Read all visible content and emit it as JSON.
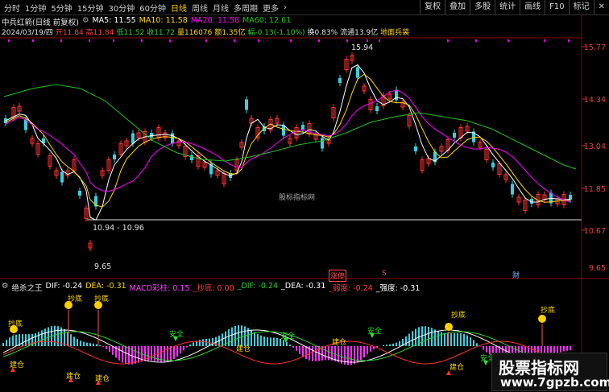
{
  "toolbar": {
    "periods": [
      "分时",
      "1分钟",
      "5分钟",
      "15分钟",
      "30分钟",
      "60分钟",
      "日线",
      "周线",
      "月线",
      "多周期",
      "更多"
    ],
    "active_period": "日线",
    "more_arrow": "›",
    "buttons": [
      "复权",
      "叠加",
      "多股",
      "统计",
      "画线",
      "F10",
      "标记"
    ],
    "close": "✕"
  },
  "ma_row": {
    "name": "中兵红箭(日线 前复权)",
    "gear_icon": "gear-icon",
    "ma5": "MA5: 11.55",
    "ma10": "MA10: 11.58",
    "ma20": "MA20: 11.58",
    "ma60": "MA60: 12.61"
  },
  "info_row": {
    "date": "2024/03/19/四",
    "open": "开11.84",
    "high": "高11.84",
    "low": "低11.52",
    "close": "收11.72",
    "volume": "量116076",
    "amount": "额1.35亿",
    "change": "幅-0.13(-1.10%)",
    "turnover": "换0.83%",
    "float": "流通13.9亿",
    "tag": "地面兵装"
  },
  "price_axis": [
    "15.77",
    "14.34",
    "13.04",
    "11.85",
    "10.67",
    "9.65"
  ],
  "annotations": {
    "high_label": "15.94",
    "low_label": "9.65",
    "range_label": "10.94 - 10.96",
    "center_wm": "股标指标网",
    "tag_zt": "涨停",
    "tag_s": "S",
    "tag_cai": "财"
  },
  "indicator_row": {
    "name": "绝杀之王",
    "dif": "DIF: -0.24",
    "dea": "DEA: -0.31",
    "macd": "MACD彩柱: 0.15",
    "chaodi": "_抄底: 0.00",
    "dif2": "_DIF: -0.24",
    "dea2": "_DEA: -0.31",
    "ruodu": "_弱度: -0.24",
    "qiangdu": "_强度: -0.31"
  },
  "signals": {
    "chaodi": "抄底",
    "jiancang": "建仓",
    "anquan": "安全"
  },
  "watermark": {
    "title": "股票指标网",
    "url": "www.7gpzb.com"
  },
  "colors": {
    "up": "#ff3333",
    "down": "#38d0e0",
    "ma5": "#ffffff",
    "ma10": "#ffd800",
    "ma20": "#ff00ff",
    "ma60": "#20c020",
    "axis": "#e04040"
  }
}
